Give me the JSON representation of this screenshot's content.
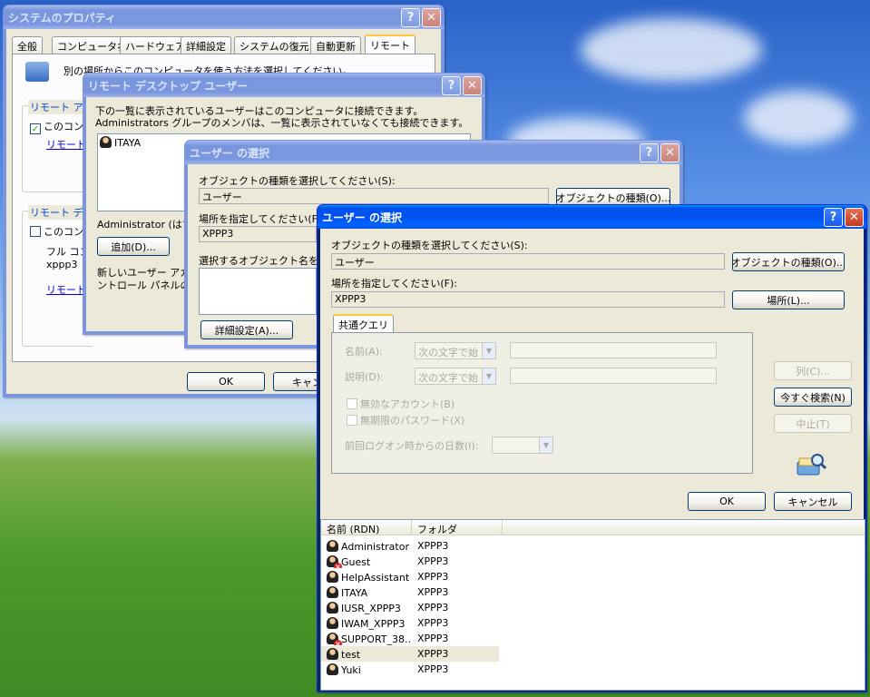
{
  "win1": {
    "title": "システムのプロパティ",
    "tabs": [
      "全般",
      "コンピュータ名",
      "ハードウェア",
      "詳細設定",
      "システムの復元",
      "自動更新",
      "リモート"
    ],
    "desc": "別の場所からこのコンピュータを使う方法を選択してください。",
    "group1": "リモート アシ",
    "check1": "このコンピ",
    "link1": "リモート",
    "group2": "リモート デス",
    "check2": "このコンピ",
    "line_a": "フル コン",
    "line_b": "xppp3",
    "link2": "リモート",
    "ok": "OK",
    "cancel": "キャンセ"
  },
  "win2": {
    "title": "リモート デスクトップ ユーザー",
    "desc": "下の一覧に表示されているユーザーはこのコンピュータに接続できます。Administrators グループのメンバは、一覧に表示されていなくても接続できます。",
    "user": "ITAYA",
    "admin_note": "Administrator (はす",
    "add": "追加(D)...",
    "note1": "新しいユーザー アカ",
    "note2": "ントロール パネルの"
  },
  "win3": {
    "title": "ユーザー の選択",
    "obj_label": "オブジェクトの種類を選択してください(S):",
    "obj_value": "ユーザー",
    "obj_btn": "オブジェクトの種類(O)...",
    "loc_label": "場所を指定してください(F):",
    "loc_value": "XPPP3",
    "name_label": "選択するオブジェクト名を入力",
    "adv_btn": "詳細設定(A)..."
  },
  "win4": {
    "title": "ユーザー の選択",
    "obj_label": "オブジェクトの種類を選択してください(S):",
    "obj_value": "ユーザー",
    "obj_btn": "オブジェクトの種類(O)...",
    "loc_label": "場所を指定してください(F):",
    "loc_value": "XPPP3",
    "loc_btn": "場所(L)...",
    "tab": "共通クエリ",
    "name_label": "名前(A):",
    "name_combo": "次の文字で始",
    "desc_label": "説明(D):",
    "desc_combo": "次の文字で始",
    "disabled_acct": "無効なアカウント(B)",
    "no_expire_pw": "無期限のパスワード(X)",
    "days_label": "前回ログオン時からの日数(I):",
    "col_btn": "列(C)...",
    "search_btn": "今すぐ検索(N)",
    "stop_btn": "中止(T)",
    "ok": "OK",
    "cancel": "キャンセル",
    "columns": [
      "名前 (RDN)",
      "フォルダ"
    ],
    "rows": [
      {
        "name": "Administrator",
        "folder": "XPPP3",
        "disabled": false
      },
      {
        "name": "Guest",
        "folder": "XPPP3",
        "disabled": true
      },
      {
        "name": "HelpAssistant",
        "folder": "XPPP3",
        "disabled": false
      },
      {
        "name": "ITAYA",
        "folder": "XPPP3",
        "disabled": false
      },
      {
        "name": "IUSR_XPPP3",
        "folder": "XPPP3",
        "disabled": false
      },
      {
        "name": "IWAM_XPPP3",
        "folder": "XPPP3",
        "disabled": false
      },
      {
        "name": "SUPPORT_38...",
        "folder": "XPPP3",
        "disabled": true
      },
      {
        "name": "test",
        "folder": "XPPP3",
        "disabled": false,
        "selected": true
      },
      {
        "name": "Yuki",
        "folder": "XPPP3",
        "disabled": false
      }
    ]
  },
  "colors": {
    "title_active": "#0054e3",
    "title_inactive": "#7a96df",
    "face": "#ece9d8"
  }
}
